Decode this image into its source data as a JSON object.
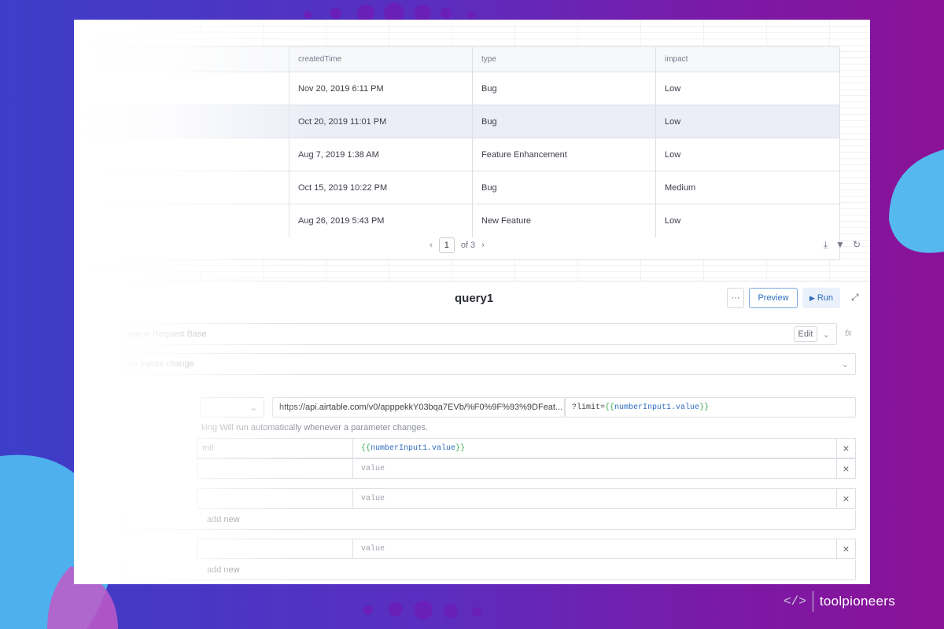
{
  "table": {
    "columns": [
      "createdTime",
      "type",
      "impact"
    ],
    "rows": [
      {
        "createdTime": "Nov 20, 2019 6:11 PM",
        "type": "Bug",
        "impact": "Low"
      },
      {
        "createdTime": "Oct 20, 2019 11:01 PM",
        "type": "Bug",
        "impact": "Low"
      },
      {
        "createdTime": "Aug 7, 2019 1:38 AM",
        "type": "Feature Enhancement",
        "impact": "Low"
      },
      {
        "createdTime": "Oct 15, 2019 10:22 PM",
        "type": "Bug",
        "impact": "Medium"
      },
      {
        "createdTime": "Aug 26, 2019 5:43 PM",
        "type": "New Feature",
        "impact": "Low"
      }
    ],
    "selected_row_index": 1,
    "pagination": {
      "current": "1",
      "of_label": "of 3"
    }
  },
  "query": {
    "title": "query1",
    "more_label": "···",
    "preview_label": "Preview",
    "run_label": "Run",
    "resource_label": "ource Request Base",
    "edit_label": "Edit",
    "trigger_label": "en inputs change",
    "url": "https://api.airtable.com/v0/apppekkY03bqa7EVb/%F0%9F%93%9DFeat...",
    "url_suffix_prefix": "?limit=",
    "url_suffix_open": "{{",
    "url_suffix_var": "numberInput1",
    "url_suffix_prop": ".value",
    "url_suffix_close": "}}",
    "auto_note": "king Will run automatically whenever a parameter changes.",
    "params": [
      {
        "key": "mit",
        "value_prefix": "{{",
        "value_var": "numberInput1",
        "value_prop": ".value",
        "value_suffix": "}}"
      },
      {
        "key": "",
        "placeholder": "value"
      }
    ],
    "headers": [
      {
        "key": "",
        "placeholder": "value"
      }
    ],
    "add_row_label": "add new",
    "body": [
      {
        "key": "",
        "placeholder": "value"
      }
    ],
    "add_row_label2": "add new"
  },
  "brand": {
    "logo": "</>",
    "name": "toolpioneers"
  }
}
